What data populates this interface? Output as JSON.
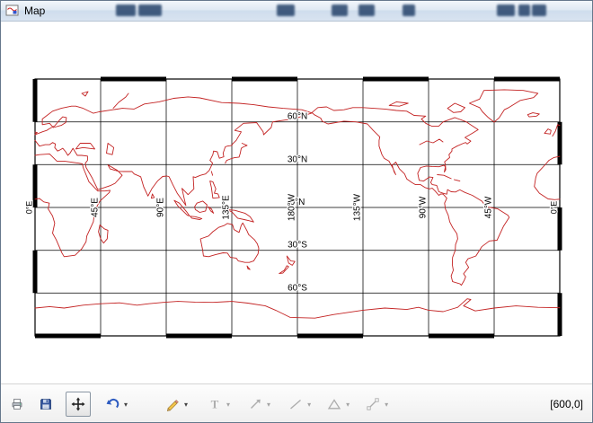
{
  "window": {
    "title": "Map"
  },
  "map": {
    "lat_labels": [
      "60°N",
      "30°N",
      "0°N",
      "30°S",
      "60°S"
    ],
    "lon_labels": [
      "45°E",
      "90°E",
      "135°E",
      "180°W",
      "135°W",
      "90°W",
      "45°W"
    ],
    "edge_label_left": "0°E",
    "edge_label_right": "0°E",
    "coastline_color": "#c32222",
    "grid_color": "#000000"
  },
  "toolbar": {
    "dropdown_glyph": "▾",
    "coordinates": "[600,0]",
    "items": [
      {
        "name": "print"
      },
      {
        "name": "save"
      },
      {
        "name": "pan"
      },
      {
        "name": "undo",
        "dropdown": true
      },
      {
        "name": "draw",
        "dropdown": true
      },
      {
        "name": "text",
        "glyph": "T",
        "dropdown": true
      },
      {
        "name": "arrow",
        "dropdown": true
      },
      {
        "name": "line",
        "dropdown": true
      },
      {
        "name": "polygon",
        "dropdown": true
      },
      {
        "name": "polyline",
        "dropdown": true
      }
    ]
  }
}
